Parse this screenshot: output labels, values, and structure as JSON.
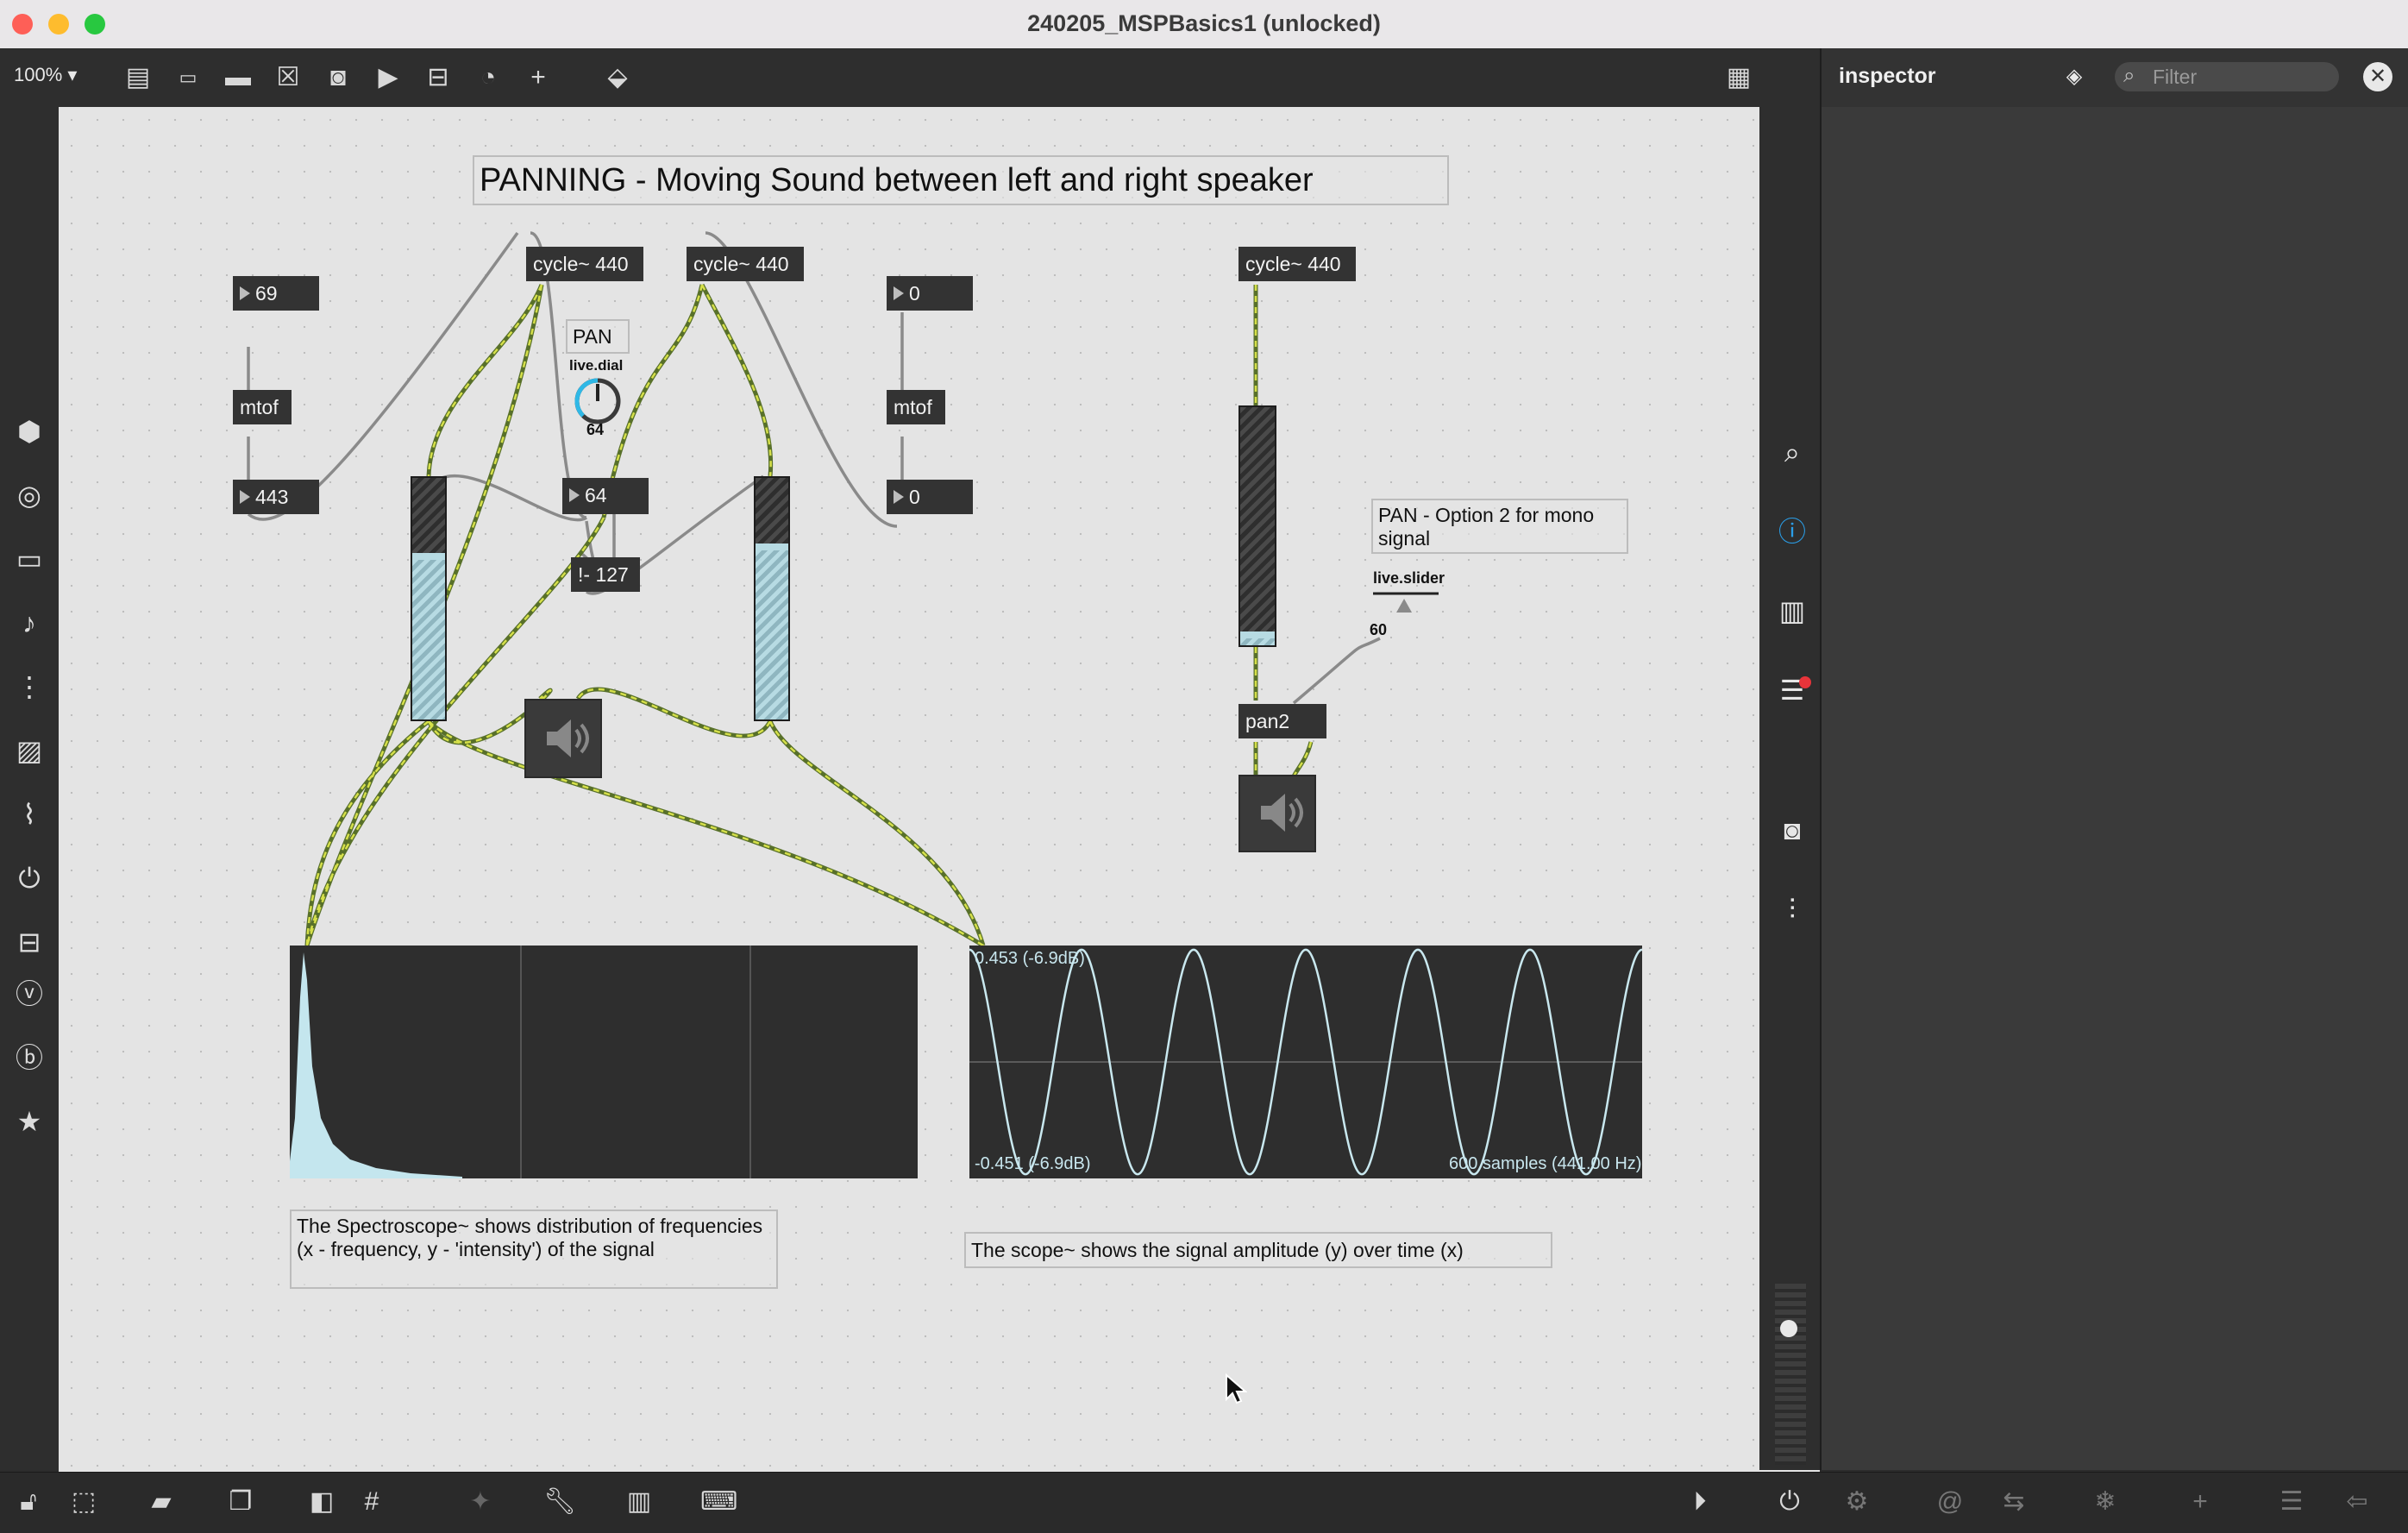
{
  "window": {
    "title": "240205_MSPBasics1 (unlocked)"
  },
  "toolbar": {
    "zoom": "100%"
  },
  "inspector": {
    "title": "inspector",
    "filter_placeholder": "Filter"
  },
  "patch": {
    "title_comment": "PANNING - Moving Sound between left and right speaker",
    "cycle1": "cycle~ 440",
    "cycle2": "cycle~ 440",
    "cycle3": "cycle~ 440",
    "num_69": "69",
    "mtof_left": "mtof",
    "num_443": "443",
    "num_0_top": "0",
    "mtof_right": "mtof",
    "num_0_bottom": "0",
    "pan_label": "PAN",
    "dial_label": "live.dial",
    "dial_value": "64",
    "num_64": "64",
    "expr": "!- 127",
    "pan2_comment": "PAN - Option 2 for mono signal",
    "slider_label": "live.slider",
    "slider_value": "60",
    "pan2": "pan2",
    "spectro_comment": "The Spectroscope~ shows distribution of frequencies (x - frequency, y - 'intensity') of the signal",
    "scope_comment": "The scope~ shows the signal amplitude (y) over time (x)",
    "scope_max": "0.453 (-6.9dB)",
    "scope_min": "-0.451 (-6.9dB)",
    "scope_info": "600 samples (441.00 Hz)"
  },
  "levels": {
    "gain_left": 0.66,
    "gain_right": 0.7,
    "gain_mono": 0.03,
    "dial": 0.5
  },
  "icons": {
    "toolbar": [
      "presentation-icon",
      "message-icon",
      "comment-icon",
      "button-icon",
      "toggle-icon",
      "number-icon",
      "slider-icon",
      "dial-icon",
      "add-icon",
      "paint-bucket-icon",
      "grid-icon"
    ],
    "sidebar": [
      "package-icon",
      "target-icon",
      "media-icon",
      "music-note-icon",
      "sequencer-icon",
      "image-icon",
      "paperclip-icon",
      "plugin-icon",
      "hardware-icon",
      "vizzie-icon",
      "beap-icon",
      "star-icon"
    ],
    "right": [
      "search-icon",
      "info-icon",
      "reference-icon",
      "list-icon",
      "snapshot-icon",
      "mixer-icon"
    ]
  }
}
